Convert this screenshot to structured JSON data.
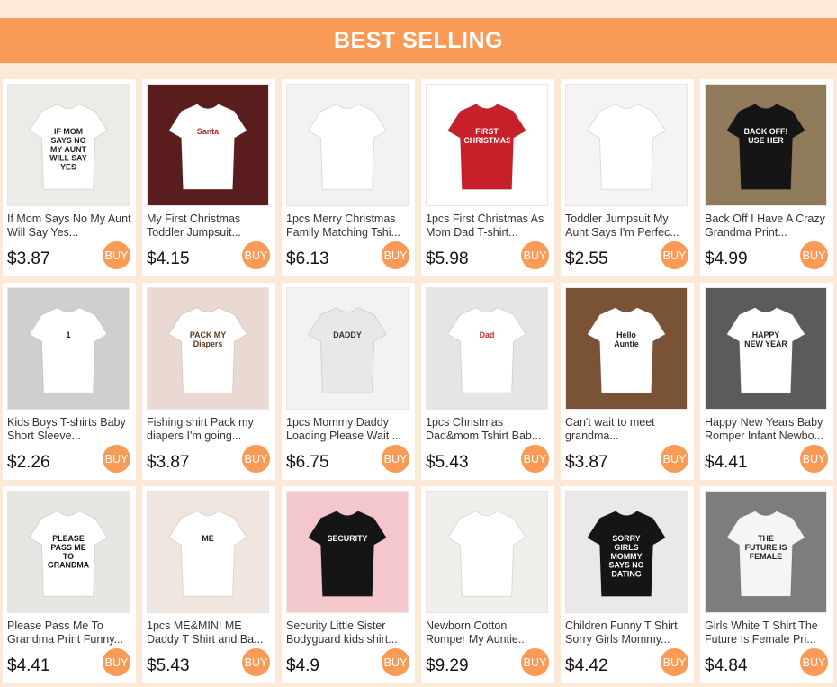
{
  "header": {
    "title": "BEST SELLING"
  },
  "buy_label": "BUY",
  "products": [
    {
      "title": "If Mom Says No My Aunt Will Say Yes...",
      "price": "$3.87",
      "image_text": "IF MOM SAYS NO MY AUNT WILL SAY YES",
      "bg": "#ecebe8",
      "shirt": "#ffffff",
      "ink": "#222222"
    },
    {
      "title": "My First Christmas Toddler Jumpsuit...",
      "price": "$4.15",
      "image_text": "Santa",
      "bg": "#5a1d1d",
      "shirt": "#ffffff",
      "ink": "#b3262a"
    },
    {
      "title": "1pcs Merry Christmas Family Matching Tshi...",
      "price": "$6.13",
      "image_text": "",
      "bg": "#f2f2f2",
      "shirt": "#ffffff",
      "ink": "#7a1a2a"
    },
    {
      "title": "1pcs First Christmas As Mom Dad T-shirt...",
      "price": "$5.98",
      "image_text": "FIRST CHRISTMAS",
      "bg": "#ffffff",
      "shirt": "#c8202a",
      "ink": "#ffffff"
    },
    {
      "title": "Toddler Jumpsuit My Aunt Says I'm Perfec...",
      "price": "$2.55",
      "image_text": "",
      "bg": "#f4f4f4",
      "shirt": "#ffffff",
      "ink": "#333333"
    },
    {
      "title": "Back Off I Have A Crazy Grandma Print...",
      "price": "$4.99",
      "image_text": "BACK OFF! USE HER",
      "bg": "#8f7a5a",
      "shirt": "#151515",
      "ink": "#ffffff"
    },
    {
      "title": "Kids Boys T-shirts Baby Short Sleeve...",
      "price": "$2.26",
      "image_text": "1",
      "bg": "#cfcfcd",
      "shirt": "#ffffff",
      "ink": "#111111"
    },
    {
      "title": "Fishing shirt Pack my diapers I'm going...",
      "price": "$3.87",
      "image_text": "PACK MY Diapers",
      "bg": "#e9d9d2",
      "shirt": "#ffffff",
      "ink": "#5a3a1a"
    },
    {
      "title": "1pcs Mommy Daddy Loading Please Wait ...",
      "price": "$6.75",
      "image_text": "DADDY",
      "bg": "#f2f2f2",
      "shirt": "#e8e8e8",
      "ink": "#333333"
    },
    {
      "title": "1pcs Christmas Dad&mom Tshirt Bab...",
      "price": "$5.43",
      "image_text": "Dad",
      "bg": "#e5e5e3",
      "shirt": "#ffffff",
      "ink": "#d42a2a"
    },
    {
      "title": "Can't wait to meet grandma...",
      "price": "$3.87",
      "image_text": "Hello Auntie",
      "bg": "#7a5236",
      "shirt": "#ffffff",
      "ink": "#222222"
    },
    {
      "title": "Happy New Years Baby Romper Infant Newbo...",
      "price": "$4.41",
      "image_text": "HAPPY NEW YEAR",
      "bg": "#5b5b5b",
      "shirt": "#ffffff",
      "ink": "#222222"
    },
    {
      "title": "Please Pass Me To Grandma Print Funny...",
      "price": "$4.41",
      "image_text": "PLEASE PASS ME TO GRANDMA",
      "bg": "#e8e6e2",
      "shirt": "#ffffff",
      "ink": "#111111"
    },
    {
      "title": "1pcs ME&MINI ME Daddy T Shirt and Ba...",
      "price": "$5.43",
      "image_text": "ME",
      "bg": "#efe7df",
      "shirt": "#ffffff",
      "ink": "#222222"
    },
    {
      "title": "Security Little Sister Bodyguard kids shirt...",
      "price": "$4.9",
      "image_text": "SECURITY",
      "bg": "#f3c7cc",
      "shirt": "#151515",
      "ink": "#ffffff"
    },
    {
      "title": "Newborn Cotton Romper My Auntie...",
      "price": "$9.29",
      "image_text": "",
      "bg": "#f1efec",
      "shirt": "#ffffff",
      "ink": "#333333"
    },
    {
      "title": "Children Funny T Shirt Sorry Girls Mommy...",
      "price": "$4.42",
      "image_text": "SORRY GIRLS MOMMY SAYS NO DATING",
      "bg": "#e9e9e9",
      "shirt": "#151515",
      "ink": "#ffffff"
    },
    {
      "title": "Girls White T Shirt The Future Is Female Pri...",
      "price": "$4.84",
      "image_text": "THE FUTURE IS FEMALE",
      "bg": "#7d7d7d",
      "shirt": "#f5f5f5",
      "ink": "#222222"
    }
  ]
}
